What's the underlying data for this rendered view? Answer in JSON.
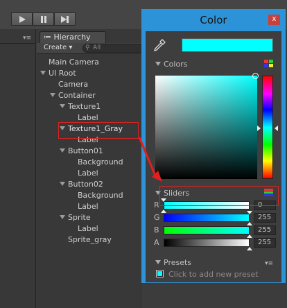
{
  "toolbar": {
    "play_icon": "play-icon",
    "pause_icon": "pause-icon",
    "step_icon": "step-icon"
  },
  "left_panel": {
    "menu_icon": "dropdown-menu-icon"
  },
  "hierarchy": {
    "tab_label": "Hierarchy",
    "create_label": "Create",
    "search_placeholder": "All",
    "items": [
      {
        "label": "Main Camera"
      },
      {
        "label": "UI Root"
      },
      {
        "label": "Camera"
      },
      {
        "label": "Container"
      },
      {
        "label": "Texture1"
      },
      {
        "label": "Label"
      },
      {
        "label": "Texture1_Gray"
      },
      {
        "label": "Label"
      },
      {
        "label": "Button01"
      },
      {
        "label": "Background"
      },
      {
        "label": "Label"
      },
      {
        "label": "Button02"
      },
      {
        "label": "Background"
      },
      {
        "label": "Label"
      },
      {
        "label": "Sprite"
      },
      {
        "label": "Label"
      },
      {
        "label": "Sprite_gray"
      }
    ]
  },
  "color_window": {
    "title": "Color",
    "close": "x",
    "current_color": "#00ffff",
    "colors_section": "Colors",
    "sliders_section": "Sliders",
    "presets_section": "Presets",
    "add_preset": "Click to add new preset",
    "sliders": [
      {
        "channel": "R",
        "value": "0",
        "fill": 0.0
      },
      {
        "channel": "G",
        "value": "255",
        "fill": 1.0
      },
      {
        "channel": "B",
        "value": "255",
        "fill": 1.0
      },
      {
        "channel": "A",
        "value": "255",
        "fill": 1.0
      }
    ]
  },
  "colors": {
    "accent": "#2d93d8",
    "highlight": "#dd2222",
    "cyan": "#00ffff"
  }
}
